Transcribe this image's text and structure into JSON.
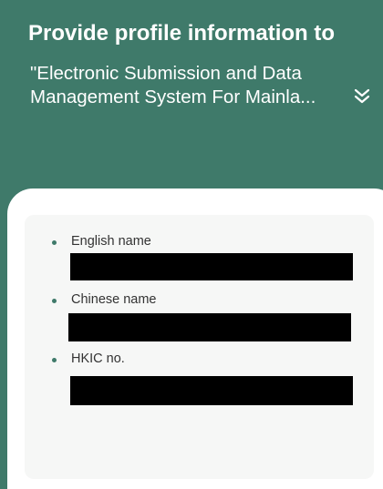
{
  "header": {
    "title": "Provide profile information to",
    "subtitle_line1": "\"Electronic Submission and Data",
    "subtitle_line2": "Management System For Mainla...",
    "expand_icon": "double-chevron-down-icon",
    "background_color": "#3f7a6a"
  },
  "fields": [
    {
      "label": "English name"
    },
    {
      "label": "Chinese name"
    },
    {
      "label": "HKIC no."
    }
  ]
}
